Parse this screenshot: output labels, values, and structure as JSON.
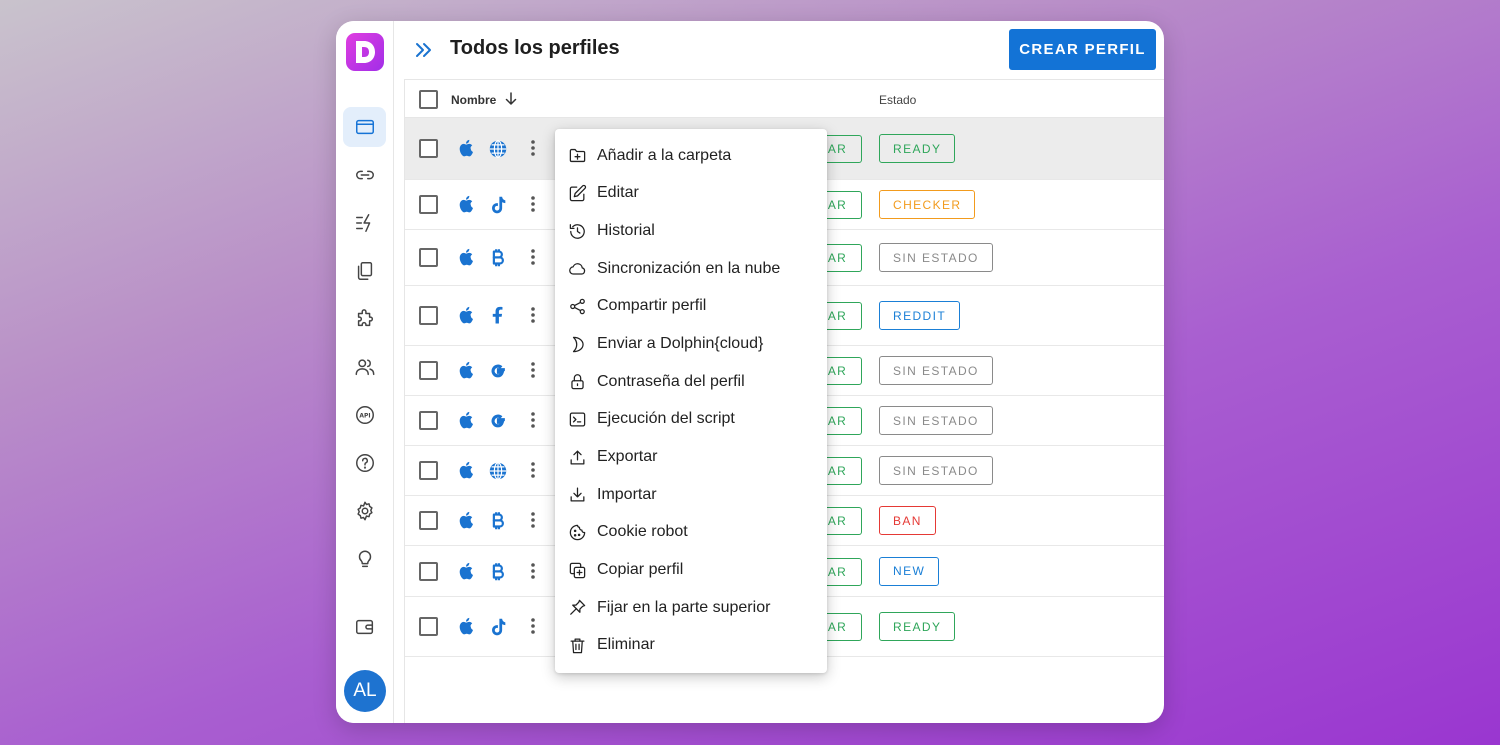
{
  "app": {
    "logo_letter": "D",
    "avatar_initials": "AL"
  },
  "header": {
    "title": "Todos los perfiles",
    "create_button": "CREAR PERFIL"
  },
  "table": {
    "columns": {
      "name": "Nombre",
      "status": "Estado"
    },
    "rows": [
      {
        "os": "apple-icon",
        "site": "globe-icon",
        "action_fragment": "AR",
        "status": "READY",
        "status_color": "#2fa65a",
        "highlight": true
      },
      {
        "os": "apple-icon",
        "site": "tiktok-icon",
        "action_fragment": "AR",
        "status": "CHECKER",
        "status_color": "#f29b1d"
      },
      {
        "os": "apple-icon",
        "site": "bitcoin-icon",
        "action_fragment": "AR",
        "status": "SIN ESTADO",
        "status_color": "#8a8a8a"
      },
      {
        "os": "apple-icon",
        "site": "facebook-icon",
        "action_fragment": "AR",
        "status": "REDDIT",
        "status_color": "#1a7fd6"
      },
      {
        "os": "apple-icon",
        "site": "google-icon",
        "action_fragment": "AR",
        "status": "SIN ESTADO",
        "status_color": "#8a8a8a"
      },
      {
        "os": "apple-icon",
        "site": "google-icon",
        "action_fragment": "AR",
        "status": "SIN ESTADO",
        "status_color": "#8a8a8a"
      },
      {
        "os": "apple-icon",
        "site": "globe-icon",
        "action_fragment": "AR",
        "status": "SIN ESTADO",
        "status_color": "#8a8a8a"
      },
      {
        "os": "apple-icon",
        "site": "bitcoin-icon",
        "action_fragment": "AR",
        "status": "BAN",
        "status_color": "#e53935"
      },
      {
        "os": "apple-icon",
        "site": "bitcoin-icon",
        "action_fragment": "AR",
        "status": "NEW",
        "status_color": "#1a7fd6"
      },
      {
        "os": "apple-icon",
        "site": "tiktok-icon",
        "action_fragment": "AR",
        "status": "READY",
        "status_color": "#2fa65a"
      }
    ]
  },
  "context_menu": {
    "items": [
      {
        "label": "Añadir a la carpeta",
        "icon": "folder-plus-icon"
      },
      {
        "label": "Editar",
        "icon": "edit-icon"
      },
      {
        "label": "Historial",
        "icon": "history-icon"
      },
      {
        "label": "Sincronización en la nube",
        "icon": "cloud-icon"
      },
      {
        "label": "Compartir perfil",
        "icon": "share-icon"
      },
      {
        "label": "Enviar a Dolphin{cloud}",
        "icon": "dolphin-icon"
      },
      {
        "label": "Contraseña del perfil",
        "icon": "lock-icon"
      },
      {
        "label": "Ejecución del script",
        "icon": "terminal-icon"
      },
      {
        "label": "Exportar",
        "icon": "upload-icon"
      },
      {
        "label": "Importar",
        "icon": "download-icon"
      },
      {
        "label": "Cookie robot",
        "icon": "cookie-icon"
      },
      {
        "label": "Copiar perfil",
        "icon": "copy-icon"
      },
      {
        "label": "Fijar en la parte superior",
        "icon": "pin-icon"
      },
      {
        "label": "Eliminar",
        "icon": "trash-icon"
      }
    ]
  },
  "colors": {
    "accent": "#1373d6",
    "brand": "#c43be6",
    "icon_blue": "#1a73d0"
  }
}
